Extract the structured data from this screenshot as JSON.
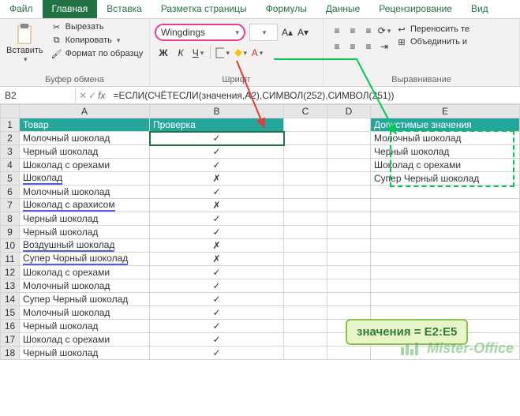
{
  "tabs": {
    "file": "Файл",
    "home": "Главная",
    "insert": "Вставка",
    "pagelayout": "Разметка страницы",
    "formulas": "Формулы",
    "data": "Данные",
    "review": "Рецензирование",
    "view": "Вид"
  },
  "ribbon": {
    "paste": "Вставить",
    "cut": "Вырезать",
    "copy": "Копировать",
    "format_painter": "Формат по образцу",
    "clipboard_group": "Буфер обмена",
    "font_name": "Wingdings",
    "font_group": "Шрифт",
    "bold": "Ж",
    "italic": "К",
    "underline": "Ч",
    "wrap": "Переносить те",
    "merge": "Объединить и",
    "align_group": "Выравнивание"
  },
  "namebox": "B2",
  "fx": "fx",
  "formula": "=ЕСЛИ(СЧЁТЕСЛИ(значения,A2),СИМВОЛ(252),СИМВОЛ(251))",
  "cols": [
    "",
    "A",
    "B",
    "C",
    "D",
    "E"
  ],
  "headers": {
    "a": "Товар",
    "b": "Проверка",
    "e": "Допустимые значения"
  },
  "valid": [
    "Молочный шоколад",
    "Черный шоколад",
    "Шоколад с орехами",
    "Супер Черный шоколад"
  ],
  "rows": [
    {
      "n": "2",
      "a": "Молочный шоколад",
      "b": "✓",
      "u": false
    },
    {
      "n": "3",
      "a": "Черный шоколад",
      "b": "✓",
      "u": false
    },
    {
      "n": "4",
      "a": "Шоколад с орехами",
      "b": "✓",
      "u": false
    },
    {
      "n": "5",
      "a": "Шоколад",
      "b": "✗",
      "u": true
    },
    {
      "n": "6",
      "a": "Молочный шоколад",
      "b": "✓",
      "u": false
    },
    {
      "n": "7",
      "a": "Шоколад с арахисом",
      "b": "✗",
      "u": true
    },
    {
      "n": "8",
      "a": "Черный шоколад",
      "b": "✓",
      "u": false
    },
    {
      "n": "9",
      "a": "Черный шоколад",
      "b": "✓",
      "u": false
    },
    {
      "n": "10",
      "a": "Воздушный шоколад",
      "b": "✗",
      "u": true
    },
    {
      "n": "11",
      "a": "Супер Чорный шоколад",
      "b": "✗",
      "u": true
    },
    {
      "n": "12",
      "a": "Шоколад с орехами",
      "b": "✓",
      "u": false
    },
    {
      "n": "13",
      "a": "Молочный шоколад",
      "b": "✓",
      "u": false
    },
    {
      "n": "14",
      "a": "Супер Черный шоколад",
      "b": "✓",
      "u": false
    },
    {
      "n": "15",
      "a": "Молочный шоколад",
      "b": "✓",
      "u": false
    },
    {
      "n": "16",
      "a": "Черный шоколад",
      "b": "✓",
      "u": false
    },
    {
      "n": "17",
      "a": "Шоколад с орехами",
      "b": "✓",
      "u": false
    },
    {
      "n": "18",
      "a": "Черный шоколад",
      "b": "✓",
      "u": false
    }
  ],
  "callout": "значения = E2:E5",
  "watermark": "Mister-Office"
}
